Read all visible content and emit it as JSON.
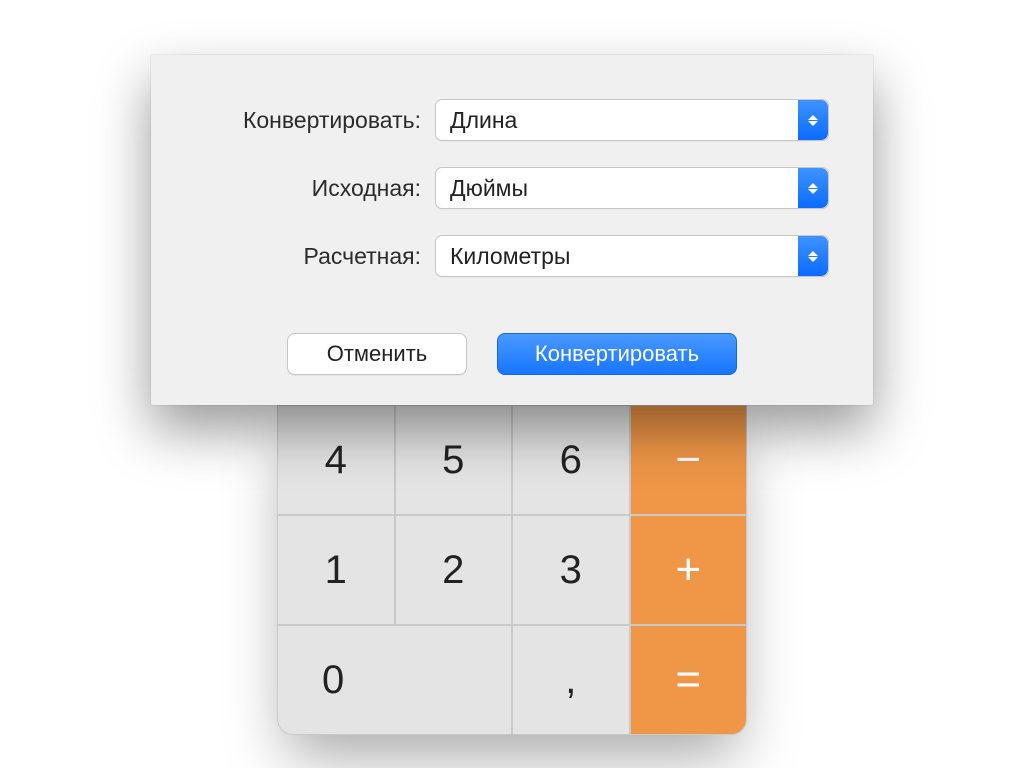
{
  "dialog": {
    "convert_label": "Конвертировать:",
    "from_label": "Исходная:",
    "to_label": "Расчетная:",
    "convert_value": "Длина",
    "from_value": "Дюймы",
    "to_value": "Километры",
    "cancel_button": "Отменить",
    "convert_button": "Конвертировать"
  },
  "calculator": {
    "keys": {
      "four": "4",
      "five": "5",
      "six": "6",
      "minus": "−",
      "one": "1",
      "two": "2",
      "three": "3",
      "plus": "+",
      "zero": "0",
      "decimal": ",",
      "equals": "="
    }
  }
}
